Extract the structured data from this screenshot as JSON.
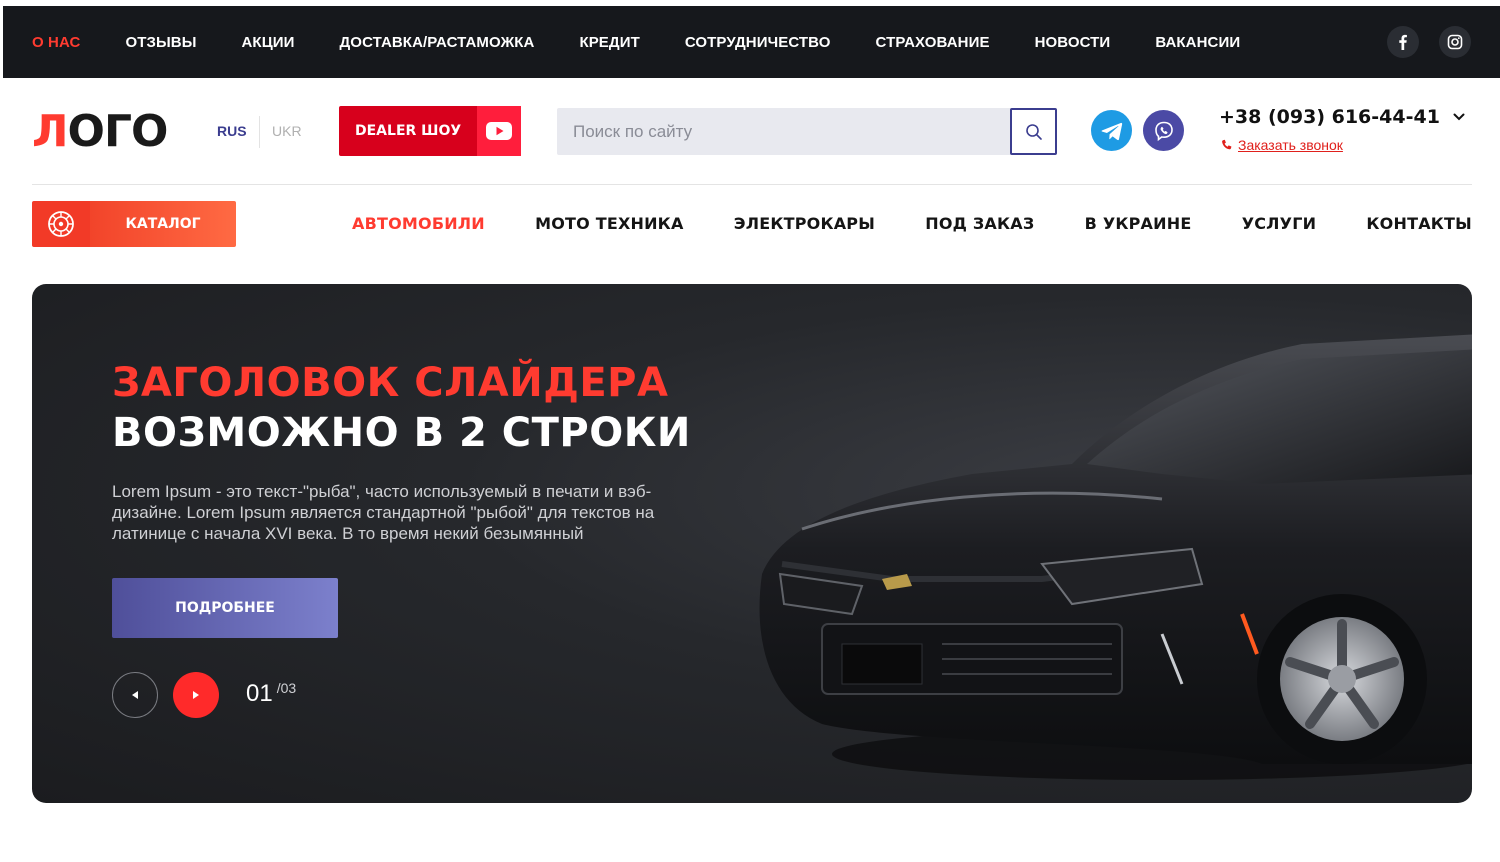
{
  "topbar": {
    "links": [
      "О НАС",
      "ОТЗЫВЫ",
      "АКЦИИ",
      "ДОСТАВКА/РАСТАМОЖКА",
      "КРЕДИТ",
      "СОТРУДНИЧЕСТВО",
      "СТРАХОВАНИЕ",
      "НОВОСТИ",
      "ВАКАНСИИ"
    ],
    "social_icons": [
      "facebook-icon",
      "instagram-icon"
    ]
  },
  "header": {
    "logo": {
      "part1": "Л",
      "part2": "ОГО"
    },
    "lang": {
      "rus": "RUS",
      "ukr": "UKR"
    },
    "dealer_button": "DEALER ШОУ",
    "search": {
      "placeholder": "Поиск по сайту"
    },
    "phone": "+38 (093) 616-44-41",
    "callback": "Заказать звонок"
  },
  "nav": {
    "catalog": "КАТАЛОГ",
    "items": [
      "АВТОМОБИЛИ",
      "МОТО ТЕХНИКА",
      "ЭЛЕКТРОКАРЫ",
      "ПОД ЗАКАЗ",
      "В УКРАИНЕ",
      "УСЛУГИ",
      "КОНТАКТЫ"
    ]
  },
  "hero": {
    "title_line1": "ЗАГОЛОВОК СЛАЙДЕРА",
    "title_line2": "ВОЗМОЖНО В 2 СТРОКИ",
    "text": "Lorem Ipsum - это текст-\"рыба\", часто используемый в печати и вэб-дизайне. Lorem Ipsum является стандартной \"рыбой\" для текстов на латинице с начала XVI века. В то время некий безымянный",
    "button": "ПОДРОБНЕЕ",
    "counter_current": "01",
    "counter_total": "/03"
  },
  "colors": {
    "accent": "#ff3b30",
    "brand_blue": "#3b3d8f",
    "topbar_bg": "#16181c",
    "dealer_red": "#d7001c"
  }
}
